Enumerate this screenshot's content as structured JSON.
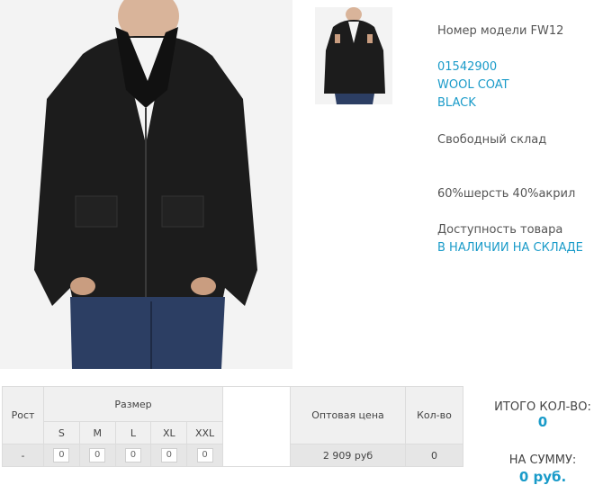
{
  "product": {
    "model_label": "Номер модели FW12",
    "code": "01542900",
    "name_line1": "WOOL COAT",
    "name_line2": "BLACK",
    "warehouse": "Свободный склад",
    "material": "60%шерсть 40%акрил",
    "availability_label": "Доступность товара",
    "availability_value": "В НАЛИЧИИ НА СКЛАДЕ"
  },
  "order_table": {
    "rost_header": "Рост",
    "razmer_header": "Размер",
    "sizes": [
      "S",
      "M",
      "L",
      "XL",
      "XXL"
    ],
    "price_header": "Оптовая цена",
    "qty_header": "Кол-во",
    "row": {
      "rost": "-",
      "quantities": [
        "0",
        "0",
        "0",
        "0",
        "0"
      ],
      "price": "2 909 руб",
      "qty": "0"
    }
  },
  "totals": {
    "qty_label": "ИТОГО КОЛ-ВО:",
    "qty_value": "0",
    "sum_label": "НА СУММУ:",
    "sum_value": "0 руб."
  },
  "colors": {
    "accent": "#1a9bc9",
    "coat": "#1c1c1c",
    "jeans": "#2c3e63"
  },
  "images": {
    "main": "jacket-photo",
    "thumbnail": "jacket-thumbnail"
  }
}
